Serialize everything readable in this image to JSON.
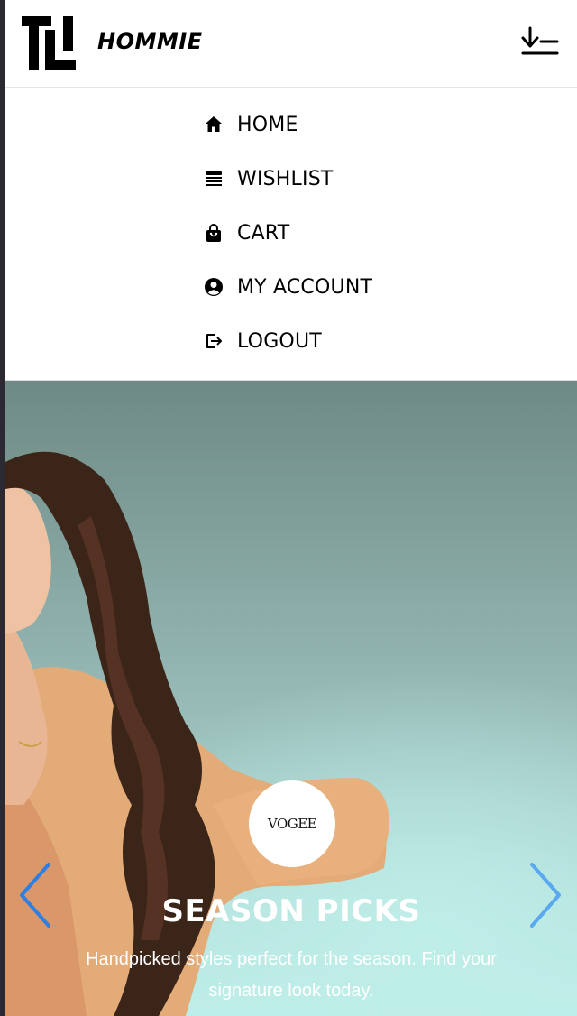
{
  "header": {
    "brand": "HOMMIE",
    "logo_icon": "hommie-logo-icon",
    "menu_toggle_icon": "sort-menu-icon"
  },
  "nav": {
    "items": [
      {
        "label": "HOME",
        "icon": "home-icon"
      },
      {
        "label": "WISHLIST",
        "icon": "list-icon"
      },
      {
        "label": "CART",
        "icon": "shopping-bag-icon"
      },
      {
        "label": "MY ACCOUNT",
        "icon": "user-circle-icon"
      },
      {
        "label": "LOGOUT",
        "icon": "logout-icon"
      }
    ]
  },
  "hero": {
    "badge": "VOGEE",
    "title": "SEASON PICKS",
    "subtitle": "Handpicked styles perfect for the season. Find your signature look today.",
    "prev_icon": "chevron-left-icon",
    "next_icon": "chevron-right-icon"
  },
  "colors": {
    "arrow": "#2f7fe0",
    "hero_top": "#6f8a84",
    "hero_bottom": "#bfeeea",
    "text": "#000000"
  }
}
